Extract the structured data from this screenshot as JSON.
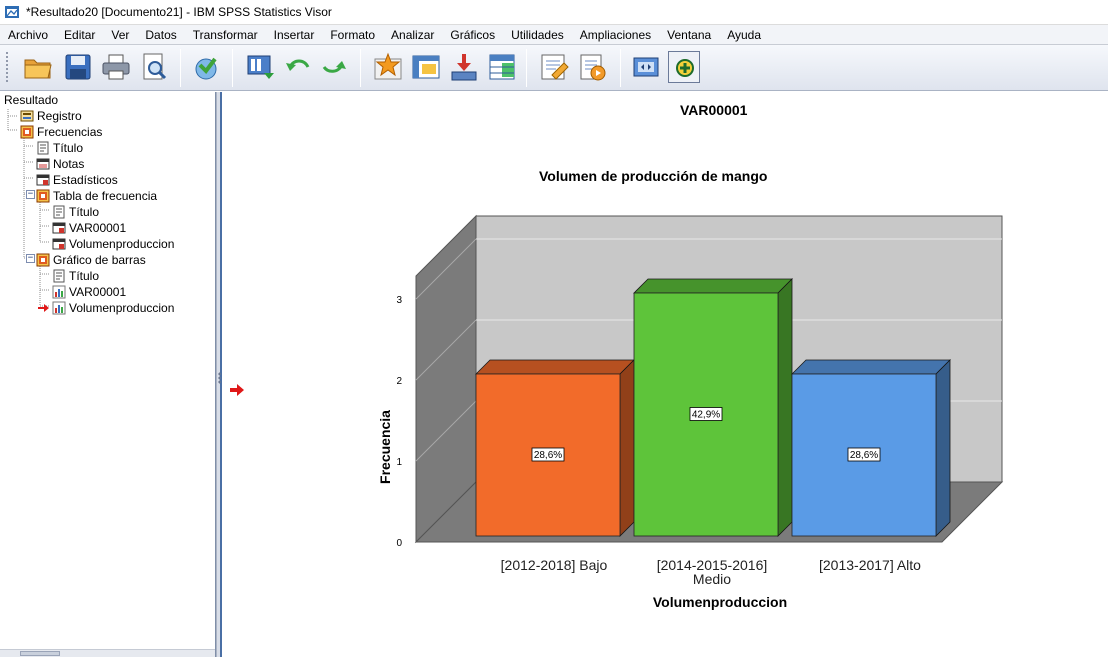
{
  "window": {
    "title": "*Resultado20 [Documento21] - IBM SPSS Statistics Visor"
  },
  "menu": [
    "Archivo",
    "Editar",
    "Ver",
    "Datos",
    "Transformar",
    "Insertar",
    "Formato",
    "Analizar",
    "Gráficos",
    "Utilidades",
    "Ampliaciones",
    "Ventana",
    "Ayuda"
  ],
  "toolbar": {
    "buttons": [
      "open-folder-icon",
      "save-icon",
      "print-icon",
      "print-preview-icon",
      "export-icon",
      "insert-data-icon",
      "undo-icon",
      "redo-icon",
      "star-goto-icon",
      "goto-case-icon",
      "weight-cases-icon",
      "split-file-icon",
      "designate-window-icon",
      "script-icon",
      "full-screen-icon",
      "add-icon"
    ]
  },
  "outline": {
    "items": [
      {
        "label": "Resultado",
        "icon": "none",
        "level": 0
      },
      {
        "label": "Registro",
        "icon": "log-icon",
        "level": 1
      },
      {
        "label": "Frecuencias",
        "icon": "procedure-icon",
        "level": 1
      },
      {
        "label": "Título",
        "icon": "title-icon",
        "level": 2
      },
      {
        "label": "Notas",
        "icon": "notes-icon",
        "level": 2
      },
      {
        "label": "Estadísticos",
        "icon": "table-icon",
        "level": 2
      },
      {
        "label": "Tabla de frecuencia",
        "icon": "procedure-icon",
        "level": 2
      },
      {
        "label": "Título",
        "icon": "title-icon",
        "level": 3
      },
      {
        "label": "VAR00001",
        "icon": "table-icon",
        "level": 3
      },
      {
        "label": "Volumenproduccion",
        "icon": "table-icon",
        "level": 3
      },
      {
        "label": "Gráfico de barras",
        "icon": "procedure-icon",
        "level": 2
      },
      {
        "label": "Título",
        "icon": "title-icon",
        "level": 3
      },
      {
        "label": "VAR00001",
        "icon": "chart-icon",
        "level": 3
      },
      {
        "label": "Volumenproduccion",
        "icon": "chart-icon",
        "level": 3
      }
    ]
  },
  "output": {
    "heading": "VAR00001"
  },
  "chart_data": {
    "type": "bar",
    "title": "Volumen de producción de mango",
    "xlabel": "Volumenproduccion",
    "ylabel": "Frecuencia",
    "categories": [
      "[2012-2018] Bajo",
      "[2014-2015-2016] Medio",
      "[2013-2017] Alto"
    ],
    "values": [
      2,
      3,
      2
    ],
    "data_labels": [
      "28,6%",
      "42,9%",
      "28,6%"
    ],
    "colors": [
      "#f26b2a",
      "#5ec43a",
      "#5a9be6"
    ],
    "yticks": [
      "0",
      "1",
      "2",
      "3"
    ],
    "ylim": [
      0,
      3
    ],
    "grid": true,
    "style": "3d"
  }
}
